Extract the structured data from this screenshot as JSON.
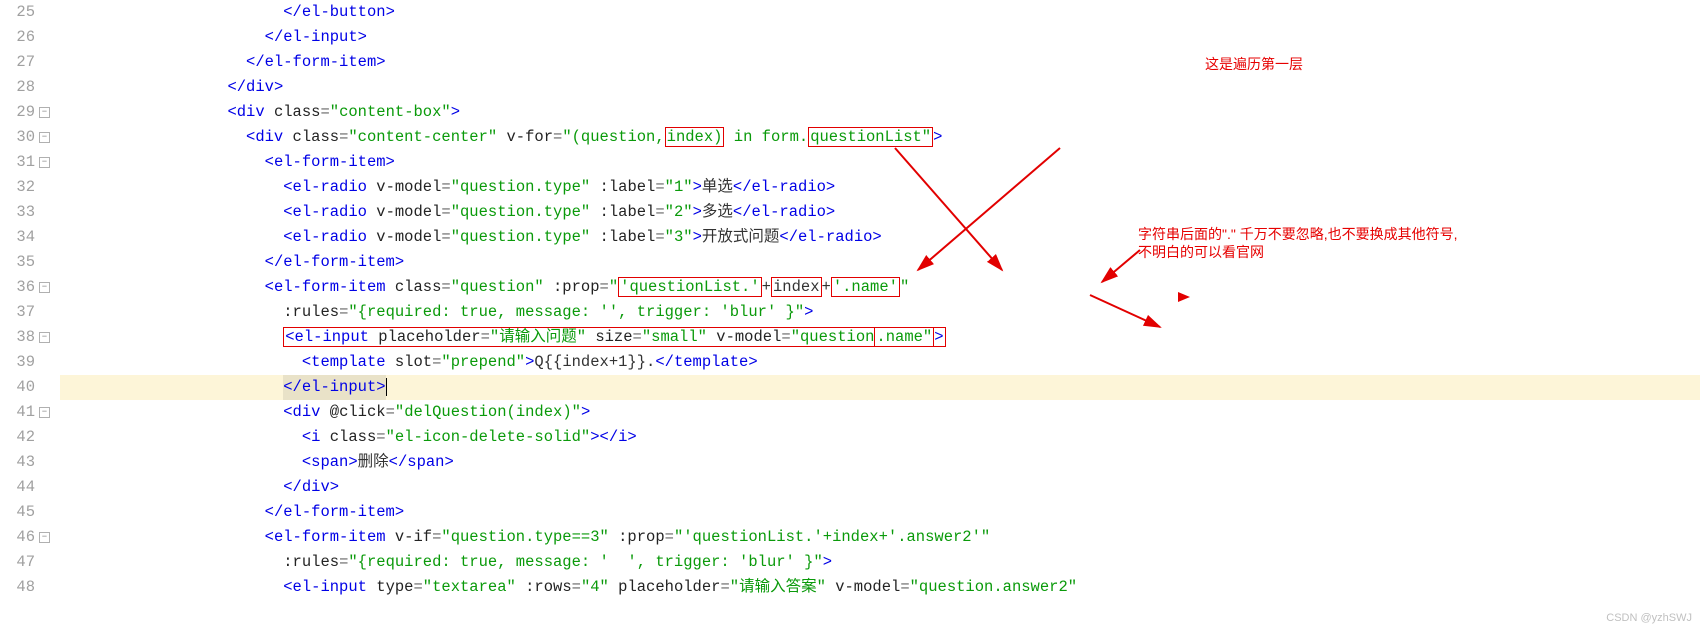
{
  "gutter": {
    "start": 25,
    "end": 48,
    "folds": [
      29,
      30,
      31,
      36,
      38,
      41,
      46
    ]
  },
  "lines": {
    "l25": {
      "pad": "                        ",
      "tag": "</el-button>"
    },
    "l26": {
      "pad": "                      ",
      "tag": "</el-input>"
    },
    "l27": {
      "pad": "                    ",
      "tag": "</el-form-item>"
    },
    "l28": {
      "pad": "                  ",
      "tag": "</div>"
    },
    "l29": {
      "pad": "                  ",
      "open": "<div",
      "a1n": " class",
      "a1v": "\"content-box\"",
      "close": ">"
    },
    "l30": {
      "pad": "                    ",
      "open": "<div",
      "a1n": " class",
      "a1v": "\"content-center\"",
      "a2n": " v-for",
      "a2v_pre": "\"(question,",
      "a2v_box": "index)",
      "a2v_mid": " in form.",
      "a2v_box2": "questionList\"",
      "close": ">"
    },
    "l31": {
      "pad": "                      ",
      "tag": "<el-form-item>"
    },
    "l32": {
      "pad": "                        ",
      "open": "<el-radio",
      "a1n": " v-model",
      "a1v": "\"question.type\"",
      "a2n": " :label",
      "a2v": "\"1\"",
      "close": ">",
      "text": "单选",
      "closing": "</el-radio>"
    },
    "l33": {
      "pad": "                        ",
      "open": "<el-radio",
      "a1n": " v-model",
      "a1v": "\"question.type\"",
      "a2n": " :label",
      "a2v": "\"2\"",
      "close": ">",
      "text": "多选",
      "closing": "</el-radio>"
    },
    "l34": {
      "pad": "                        ",
      "open": "<el-radio",
      "a1n": " v-model",
      "a1v": "\"question.type\"",
      "a2n": " :label",
      "a2v": "\"3\"",
      "close": ">",
      "text": "开放式问题",
      "closing": "</el-radio>"
    },
    "l35": {
      "pad": "                      ",
      "tag": "</el-form-item>"
    },
    "l36": {
      "pad": "                      ",
      "open": "<el-form-item",
      "a1n": " class",
      "a1v": "\"question\"",
      "a2n": " :prop",
      "a2v_lit1": "\"",
      "a2v_box1": "'questionList.'",
      "a2v_plus1": "+",
      "a2v_box2": "index",
      "a2v_plus2": "+",
      "a2v_box3": "'.name'",
      "a2v_lit2": "\""
    },
    "l37": {
      "pad": "                        ",
      "a1n": ":rules",
      "a1v": "\"{required: true, message: '', trigger: 'blur' }\"",
      "close": ">"
    },
    "l38": {
      "pad": "                        ",
      "open": "<el-input",
      "a1n": " placeholder",
      "a1v": "\"请输入问题\"",
      "a2n": " size",
      "a2v": "\"small\"",
      "a3n": " v-model",
      "a3v_pre": "\"question",
      "a3v_box": ".name\"",
      "close": ">"
    },
    "l39": {
      "pad": "                          ",
      "open": "<template",
      "a1n": " slot",
      "a1v": "\"prepend\"",
      "close": ">",
      "text": "Q{{index+1}}.",
      "closing": "</template>"
    },
    "l40": {
      "pad": "                        ",
      "tag": "</el-input>"
    },
    "l41": {
      "pad": "                        ",
      "open": "<div",
      "a1n": " @click",
      "a1v": "\"delQuestion(index)\"",
      "close": ">"
    },
    "l42": {
      "pad": "                          ",
      "open": "<i",
      "a1n": " class",
      "a1v": "\"el-icon-delete-solid\"",
      "close": ">",
      "closing": "</i>"
    },
    "l43": {
      "pad": "                          ",
      "open": "<span>",
      "text": "删除",
      "closing": "</span>"
    },
    "l44": {
      "pad": "                        ",
      "tag": "</div>"
    },
    "l45": {
      "pad": "                      ",
      "tag": "</el-form-item>"
    },
    "l46": {
      "pad": "                      ",
      "open": "<el-form-item",
      "a1n": " v-if",
      "a1v": "\"question.type==3\"",
      "a2n": " :prop",
      "a2v": "\"'questionList.'+index+'.answer2'\""
    },
    "l47": {
      "pad": "                        ",
      "a1n": ":rules",
      "a1v": "\"{required: true, message: '  ', trigger: 'blur' }\"",
      "close": ">"
    },
    "l48": {
      "pad": "                        ",
      "open": "<el-input",
      "a1n": " type",
      "a1v": "\"textarea\"",
      "a2n": " :rows",
      "a2v": "\"4\"",
      "a3n": " placeholder",
      "a3v": "\"请输入答案\"",
      "a4n": " v-model",
      "a4v": "\"question.answer2\""
    }
  },
  "annotations": {
    "a1": "这是遍历第一层",
    "a2_line1": "字符串后面的\".\" 千万不要忽略,也不要换成其他符号,",
    "a2_line2": "不明白的可以看官网"
  },
  "watermark": "CSDN @yzhSWJ"
}
